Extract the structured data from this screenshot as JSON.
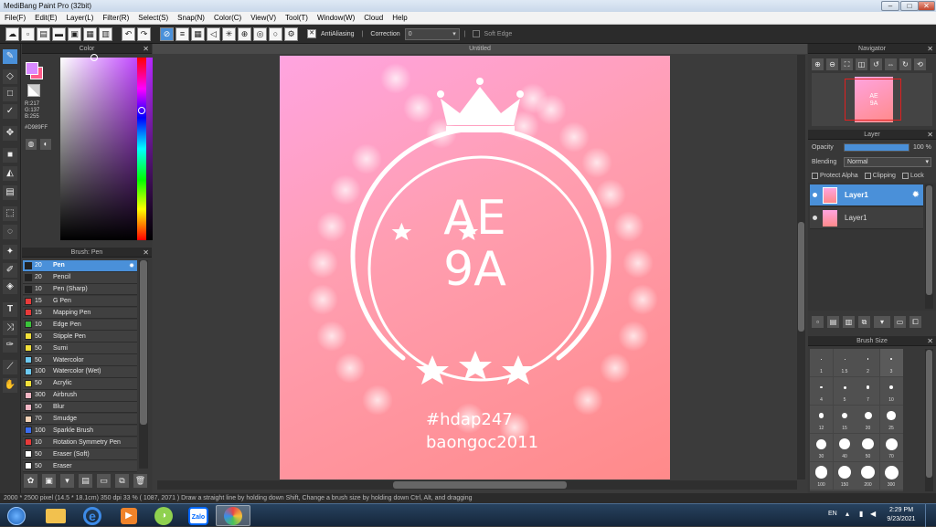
{
  "window": {
    "title": "MediBang Paint Pro (32bit)"
  },
  "menu": [
    "File(F)",
    "Edit(E)",
    "Layer(L)",
    "Filter(R)",
    "Select(S)",
    "Snap(N)",
    "Color(C)",
    "View(V)",
    "Tool(T)",
    "Window(W)",
    "Cloud",
    "Help"
  ],
  "toolbar": {
    "antialiasing": "AntiAliasing",
    "correction_label": "Correction",
    "correction_value": "0",
    "soft_edge": "Soft Edge"
  },
  "color_panel": {
    "title": "Color",
    "rgb": [
      "R:217",
      "G:137",
      "B:255"
    ],
    "hex": "#D989FF"
  },
  "brush_panel": {
    "title": "Brush: Pen",
    "brushes": [
      {
        "size": "20",
        "name": "Pen",
        "color": "#222222"
      },
      {
        "size": "20",
        "name": "Pencil",
        "color": "#222222"
      },
      {
        "size": "10",
        "name": "Pen (Sharp)",
        "color": "#222222"
      },
      {
        "size": "15",
        "name": "G Pen",
        "color": "#e83a3a"
      },
      {
        "size": "15",
        "name": "Mapping Pen",
        "color": "#e83a3a"
      },
      {
        "size": "10",
        "name": "Edge Pen",
        "color": "#3ac43a"
      },
      {
        "size": "50",
        "name": "Stipple Pen",
        "color": "#f2e03a"
      },
      {
        "size": "50",
        "name": "Sumi",
        "color": "#f2e03a"
      },
      {
        "size": "50",
        "name": "Watercolor",
        "color": "#6cc9f0"
      },
      {
        "size": "100",
        "name": "Watercolor (Wet)",
        "color": "#6cc9f0"
      },
      {
        "size": "50",
        "name": "Acrylic",
        "color": "#f2e03a"
      },
      {
        "size": "300",
        "name": "Airbrush",
        "color": "#f2b6c4"
      },
      {
        "size": "50",
        "name": "Blur",
        "color": "#f2b6c4"
      },
      {
        "size": "70",
        "name": "Smudge",
        "color": "#f2d2b6"
      },
      {
        "size": "100",
        "name": "Sparkle Brush",
        "color": "#3a6cf0"
      },
      {
        "size": "10",
        "name": "Rotation Symmetry Pen",
        "color": "#e83a3a"
      },
      {
        "size": "50",
        "name": "Eraser (Soft)",
        "color": "#ffffff"
      },
      {
        "size": "50",
        "name": "Eraser",
        "color": "#ffffff"
      }
    ]
  },
  "canvas": {
    "title": "Untitled",
    "art_line1": "AE",
    "art_line2": "9A",
    "caption1": "#hdap247",
    "caption2": "baongoc2011"
  },
  "navigator": {
    "title": "Navigator"
  },
  "layer_panel": {
    "title": "Layer",
    "opacity_label": "Opacity",
    "opacity_value": "100 %",
    "opacity": 1.0,
    "blending_label": "Blending",
    "blending_value": "Normal",
    "protect_alpha": "Protect Alpha",
    "clipping": "Clipping",
    "lock": "Lock",
    "layers": [
      {
        "name": "Layer1"
      },
      {
        "name": "Layer1"
      }
    ]
  },
  "brush_size_panel": {
    "title": "Brush Size",
    "sizes": [
      "1",
      "1.5",
      "2",
      "3",
      "4",
      "5",
      "7",
      "10",
      "12",
      "15",
      "20",
      "25",
      "30",
      "40",
      "50",
      "70",
      "100",
      "150",
      "200",
      "300"
    ]
  },
  "status": {
    "text": "2000 * 2500 pixel  (14.5 * 18.1cm)  350 dpi  33 %  ( 1087, 2071 )  Draw a straight line by holding down Shift, Change a brush size by holding down Ctrl, Alt, and dragging"
  },
  "taskbar": {
    "lang": "EN",
    "time": "2:29 PM",
    "date": "9/23/2021",
    "zalo": "Zalo"
  }
}
